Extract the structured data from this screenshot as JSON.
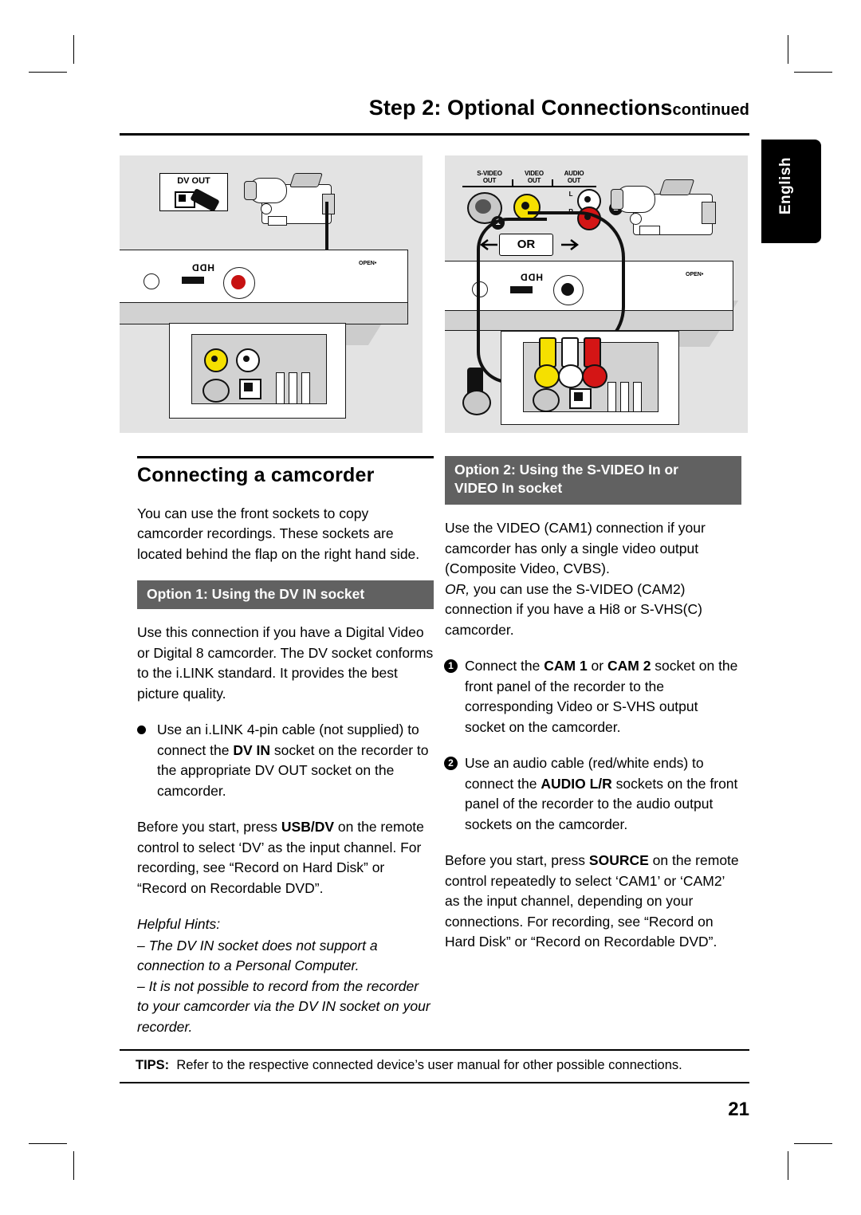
{
  "header": {
    "step_title": "Step 2: Optional Connections",
    "continued": "continued"
  },
  "side_tab": {
    "label": "English"
  },
  "figures": {
    "left": {
      "name": "dv-in-connection-diagram",
      "labels": {
        "dv_out": "DV OUT"
      }
    },
    "right": {
      "name": "svideo-video-audio-connection-diagram",
      "labels": {
        "svideo_out_line1": "S-VIDEO",
        "svideo_out_line2": "OUT",
        "video_out_line1": "VIDEO",
        "video_out_line2": "OUT",
        "audio_out_line1": "AUDIO",
        "audio_out_line2": "OUT",
        "audio_l": "L",
        "audio_r": "R",
        "or": "OR",
        "badge1": "1",
        "badge2": "2"
      }
    }
  },
  "left_column": {
    "title": "Connecting a camcorder",
    "intro": "You can use the front sockets to copy camcorder recordings. These sockets are located behind the flap on the right hand side.",
    "option1_bar": "Option 1: Using the DV IN socket",
    "option1_p1": "Use this connection if you have a Digital Video or Digital 8 camcorder. The DV socket conforms to the i.LINK standard. It provides the best picture quality.",
    "option1_bullet_pre": "Use an i.LINK 4-pin cable (not supplied) to connect the ",
    "option1_bullet_bold": "DV IN",
    "option1_bullet_post": " socket on the recorder to the appropriate DV OUT socket on the camcorder.",
    "option1_p2_pre": "Before you start, press ",
    "option1_p2_bold": "USB/DV",
    "option1_p2_post": " on the remote control to select ‘DV’ as the input channel. For recording, see “Record on Hard Disk” or “Record on Recordable DVD”.",
    "hints_title": "Helpful Hints:",
    "hint1": "– The DV IN socket does not support a connection to a Personal Computer.",
    "hint2": "– It is not possible to record from the recorder to your camcorder via the DV IN socket on your recorder."
  },
  "right_column": {
    "option2_bar_line1_pre": "Option 2: Using the ",
    "option2_bar_bold": "S-VIDEO",
    "option2_bar_line1_post": " In or",
    "option2_bar_line2": "VIDEO In socket",
    "p1": "Use the VIDEO (CAM1) connection if your camcorder has only a single video output (Composite Video, CVBS).",
    "p2_italic": "OR,",
    "p2_rest": " you can use the S-VIDEO (CAM2) connection if you have a Hi8 or S-VHS(C) camcorder.",
    "step1_pre": "Connect the ",
    "step1_b1": "CAM 1",
    "step1_mid": " or ",
    "step1_b2": "CAM 2",
    "step1_post": " socket on the front panel of the recorder to the corresponding Video or S-VHS output socket on the camcorder.",
    "step2_pre": "Use an audio cable (red/white ends) to connect the ",
    "step2_bold": "AUDIO L/R",
    "step2_post": " sockets on the front panel of the recorder to the audio output sockets on the camcorder.",
    "p3_pre": "Before you start, press ",
    "p3_bold": "SOURCE",
    "p3_post": " on the remote control repeatedly to select ‘CAM1’ or ‘CAM2’ as the input channel, depending on your connections. For recording, see “Record on Hard Disk” or “Record on Recordable DVD”.",
    "badge1": "1",
    "badge2": "2"
  },
  "footer": {
    "tips_label": "TIPS:",
    "tips_text": "Refer to the respective connected device’s user manual for other possible connections.",
    "page_number": "21"
  },
  "colors": {
    "option_bar": "#616161",
    "panel_bg": "#e3e3e3",
    "yellow": "#f5e000",
    "red": "#d41515",
    "white_plug": "#ffffff"
  }
}
